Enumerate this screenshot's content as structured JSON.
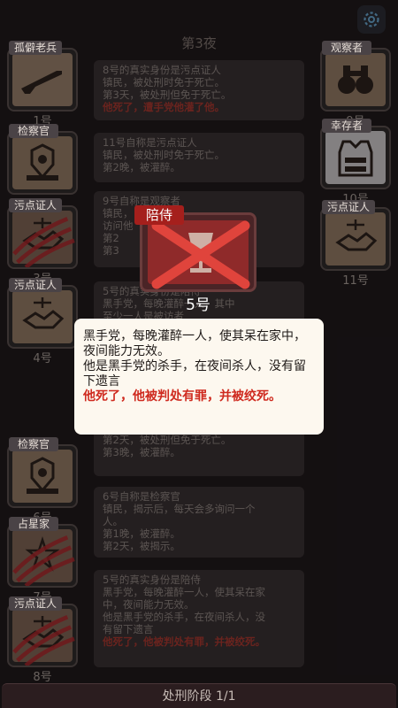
{
  "header": {
    "round_title": "第3夜"
  },
  "icons": {
    "settings": "gear-icon"
  },
  "players": [
    {
      "id": "1",
      "role_tag": "孤僻老兵",
      "number": "1号",
      "icon": "rifle-icon",
      "dead": false
    },
    {
      "id": "2",
      "role_tag": "检察官",
      "number": "2号",
      "icon": "badge-icon",
      "dead": false
    },
    {
      "id": "3",
      "role_tag": "污点证人",
      "number": "3号",
      "icon": "handshake-icon",
      "dead": true
    },
    {
      "id": "4",
      "role_tag": "污点证人",
      "number": "4号",
      "icon": "handshake-icon",
      "dead": false
    },
    {
      "id": "6",
      "role_tag": "检察官",
      "number": "6号",
      "icon": "badge-icon",
      "dead": false
    },
    {
      "id": "7",
      "role_tag": "占星家",
      "number": "7号",
      "icon": "star-icon",
      "dead": true
    },
    {
      "id": "8",
      "role_tag": "污点证人",
      "number": "8号",
      "icon": "handshake-icon",
      "dead": true
    },
    {
      "id": "9",
      "role_tag": "观察者",
      "number": "9号",
      "icon": "binoculars-icon",
      "dead": false
    },
    {
      "id": "10",
      "role_tag": "幸存者",
      "number": "10号",
      "icon": "vest-icon",
      "dead": false
    },
    {
      "id": "11",
      "role_tag": "污点证人",
      "number": "11号",
      "icon": "handshake-icon",
      "dead": false
    }
  ],
  "log": [
    {
      "lines": [
        "8号的真实身份是污点证人",
        "镇民，被处刑时免于死亡。",
        "第3天，被处刑但免于死亡。"
      ],
      "red": "他死了，遭手党他灌了他。"
    },
    {
      "lines": [
        "11号自称是污点证人",
        "镇民，被处刑时免于死亡。",
        "第2晚，被灌醉。"
      ],
      "red": ""
    },
    {
      "lines": [
        "9号自称是观察者",
        "镇民，",
        "访问他",
        "第2",
        "第3"
      ],
      "red": ""
    },
    {
      "lines": [
        "5号的真实身份是陪侍",
        "黑手党，每晚灌醉一人，其中",
        "至少一人是被访者"
      ],
      "red": ""
    },
    {
      "lines": [
        "",
        "第2天，被处刑但免于死亡。",
        "第3晚，被灌醉。"
      ],
      "red": ""
    },
    {
      "lines": [
        "6号自称是检察官",
        "镇民，揭示后，每天会多询问一个",
        "人。",
        "第1晚，被灌醉。",
        "第2天，被揭示。"
      ],
      "red": ""
    },
    {
      "lines": [
        "5号的真实身份是陪侍",
        "黑手党，每晚灌醉一人，使其呆在家",
        "中，夜间能力无效。",
        "他是黑手党的杀手，在夜间杀人，没",
        "有留下遗言"
      ],
      "red": "他死了，他被判处有罪，并被绞死。"
    }
  ],
  "reveal": {
    "role_badge": "陪侍",
    "number": "5号",
    "description": "黑手党，每晚灌醉一人，使其呆在家中，夜间能力无效。",
    "extra": "他是黑手党的杀手，在夜间杀人，没有留下遗言",
    "death": "他死了，他被判处有罪，并被绞死。"
  },
  "footer": {
    "phase": "处刑阶段 1/1"
  }
}
